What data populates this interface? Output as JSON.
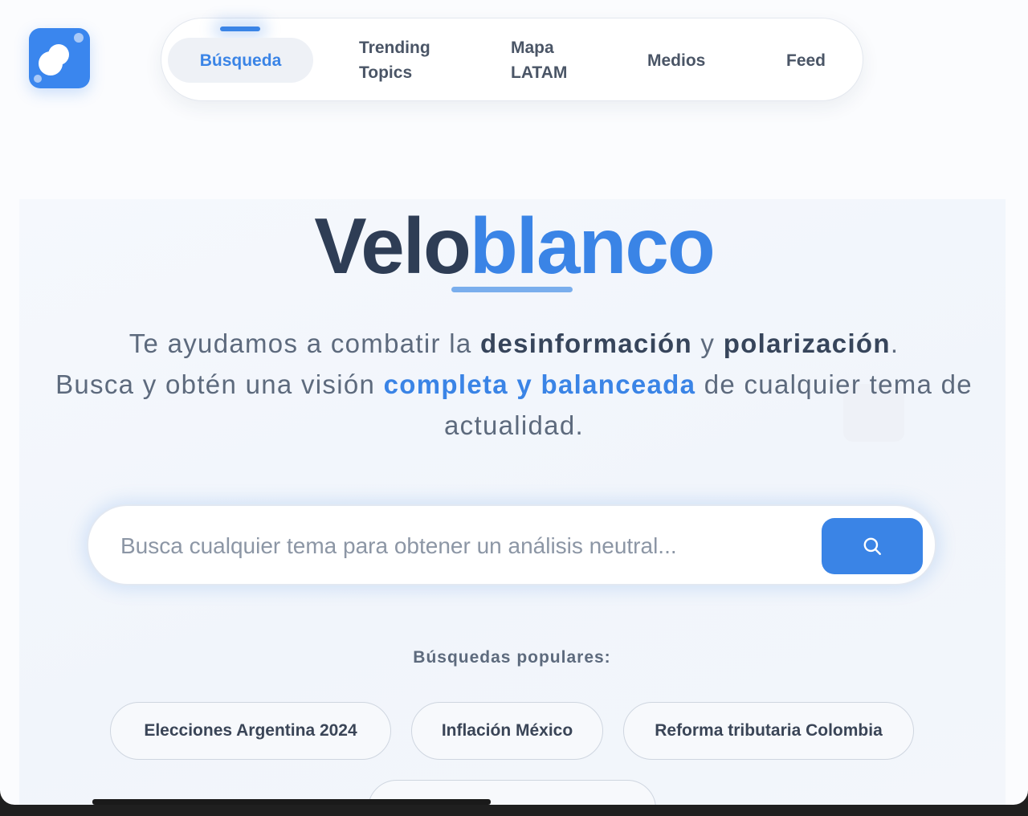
{
  "app": {
    "logo_icon": "veloblanco-logo-icon",
    "accent_color": "#3a84e6"
  },
  "nav": {
    "items": [
      {
        "label": "Búsqueda",
        "active": true
      },
      {
        "label_line1": "Trending",
        "label_line2": "Topics"
      },
      {
        "label_line1": "Mapa",
        "label_line2": "LATAM"
      },
      {
        "label": "Medios"
      },
      {
        "label": "Feed"
      }
    ]
  },
  "hero": {
    "brand_part1": "Velo",
    "brand_part2": "blanco",
    "tagline": {
      "l1_a": "Te ayudamos a combatir la ",
      "l1_b": "desinformación",
      "l1_c": " y ",
      "l1_d": "polarización",
      "l1_e": ".",
      "l2_a": "Busca y obtén una visión ",
      "l2_b": "completa y balanceada",
      "l2_c": " de cualquier tema de actualidad."
    }
  },
  "search": {
    "placeholder": "Busca cualquier tema para obtener un análisis neutral...",
    "button_icon": "search-icon"
  },
  "popular": {
    "label": "Búsquedas populares:",
    "chips": [
      "Elecciones Argentina 2024",
      "Inflación México",
      "Reforma tributaria Colombia"
    ]
  }
}
